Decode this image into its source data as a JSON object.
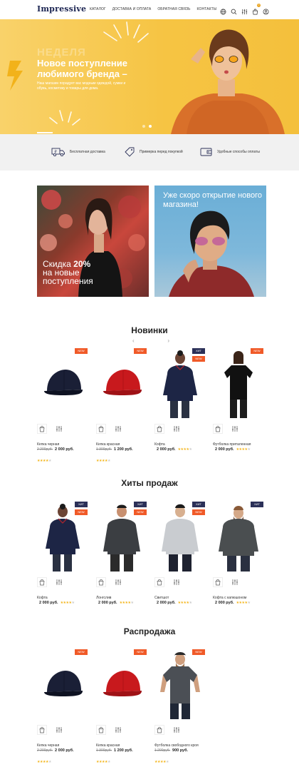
{
  "header": {
    "logo": "Impressive",
    "nav": [
      "КАТАЛОГ",
      "ДОСТАВКА И ОПЛАТА",
      "ОБРАТНАЯ СВЯЗЬ",
      "КОНТАКТЫ"
    ],
    "cart_count": "0"
  },
  "hero": {
    "eyebrow": "НЕДЕЛЯ",
    "title": "Новое поступление любимого бренда –",
    "subtitle": "Наш магазин порадует вас модным одеждой, сумки и обувь, косметику и товары для дома.",
    "active_slide": 2,
    "slides": 2
  },
  "features": [
    {
      "label": "Бесплатная доставка",
      "icon": "truck-icon"
    },
    {
      "label": "Примерка перед покупкой",
      "icon": "tag-icon"
    },
    {
      "label": "Удобные способы оплаты",
      "icon": "wallet-icon"
    }
  ],
  "promo": {
    "left": {
      "line1_pre": "Скидка ",
      "line1_bold": "20%",
      "line2": "на новые",
      "line3": "поступления"
    },
    "right": {
      "text": "Уже скоро открытие нового магазина!"
    }
  },
  "sections": {
    "novelties": {
      "title": "Новинки",
      "products": [
        {
          "name": "Кепка черная",
          "old": "2 200руб.",
          "price": "2 000 руб.",
          "rating": 4,
          "tags": [
            "NEW"
          ],
          "img": "black-cap"
        },
        {
          "name": "Кепка красная",
          "old": "1 300руб.",
          "price": "1 200 руб.",
          "rating": 4,
          "tags": [
            "NEW"
          ],
          "img": "red-cap"
        },
        {
          "name": "Кофта",
          "old": "",
          "price": "2 000 руб.",
          "rating": 4,
          "tags": [
            "ХИТ",
            "NEW"
          ],
          "img": "navy-sweater"
        },
        {
          "name": "Футболка приталенная",
          "old": "",
          "price": "2 000 руб.",
          "rating": 4,
          "tags": [
            "NEW"
          ],
          "img": "black-tshirt"
        }
      ]
    },
    "hits": {
      "title": "Хиты продаж",
      "products": [
        {
          "name": "Кофта",
          "old": "",
          "price": "2 000 руб.",
          "rating": 4,
          "tags": [
            "ХИТ",
            "NEW"
          ],
          "img": "navy-sweater"
        },
        {
          "name": "Лонгслив",
          "old": "",
          "price": "2 000 руб.",
          "rating": 4,
          "tags": [
            "ХИТ",
            "NEW"
          ],
          "img": "gray-longsleeve"
        },
        {
          "name": "Свитшот",
          "old": "",
          "price": "2 000 руб.",
          "rating": 4,
          "tags": [
            "ХИТ",
            "NEW"
          ],
          "img": "light-sweatshirt"
        },
        {
          "name": "Кофта с капюшоном",
          "old": "",
          "price": "2 000 руб.",
          "rating": 4,
          "tags": [
            "ХИТ"
          ],
          "img": "gray-hoodie"
        }
      ]
    },
    "sale": {
      "title": "Распродажа",
      "products": [
        {
          "name": "Кепка черная",
          "old": "2 200руб.",
          "price": "2 000 руб.",
          "rating": 4,
          "tags": [
            "NEW"
          ],
          "img": "black-cap"
        },
        {
          "name": "Кепка красная",
          "old": "1 300руб.",
          "price": "1 200 руб.",
          "rating": 4,
          "tags": [
            "NEW"
          ],
          "img": "red-cap"
        },
        {
          "name": "Футболка свободного кроя",
          "old": "1 200руб.",
          "price": "900 руб.",
          "rating": 4,
          "tags": [
            "NEW"
          ],
          "img": "gray-tshirt-man"
        }
      ]
    }
  },
  "colors": {
    "accent": "#f4c03c",
    "new_tag": "#f05a28",
    "hit_tag": "#2b3058",
    "star": "#f3b51c"
  }
}
